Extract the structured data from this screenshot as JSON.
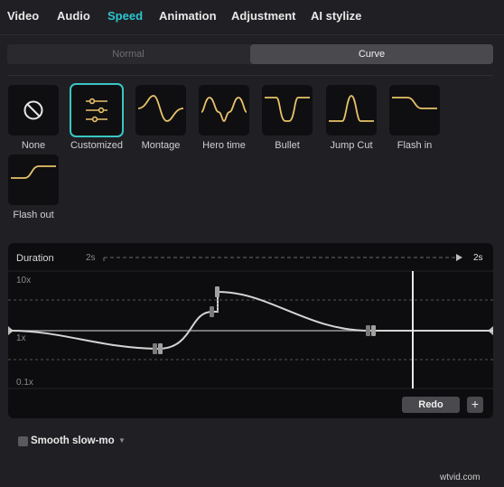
{
  "tabs": [
    {
      "label": "Video",
      "active": false
    },
    {
      "label": "Audio",
      "active": false
    },
    {
      "label": "Speed",
      "active": true
    },
    {
      "label": "Animation",
      "active": false
    },
    {
      "label": "Adjustment",
      "active": false
    },
    {
      "label": "AI stylize",
      "active": false
    }
  ],
  "mode": {
    "normal": "Normal",
    "curve": "Curve",
    "selected": "Curve"
  },
  "presets": [
    {
      "label": "None",
      "icon": "none-icon"
    },
    {
      "label": "Customized",
      "icon": "customized-sliders-icon",
      "selected": true
    },
    {
      "label": "Montage",
      "icon": "montage-curve-icon"
    },
    {
      "label": "Hero time",
      "icon": "hero-time-curve-icon"
    },
    {
      "label": "Bullet",
      "icon": "bullet-curve-icon"
    },
    {
      "label": "Jump Cut",
      "icon": "jump-cut-curve-icon"
    },
    {
      "label": "Flash in",
      "icon": "flash-in-curve-icon"
    },
    {
      "label": "Flash out",
      "icon": "flash-out-curve-icon"
    }
  ],
  "curve_editor": {
    "duration_label": "Duration",
    "duration_start": "2s",
    "duration_end": "2s",
    "y_max": "10x",
    "y_mid": "1x",
    "y_min": "0.1x",
    "redo": "Redo",
    "add": "+"
  },
  "smooth_slowmo": {
    "label": "Smooth slow-mo",
    "checked": false
  },
  "watermark": "wtvid.com",
  "colors": {
    "accent": "#2cc6d0",
    "curve_gold": "#e8c26a",
    "background": "#202024"
  }
}
